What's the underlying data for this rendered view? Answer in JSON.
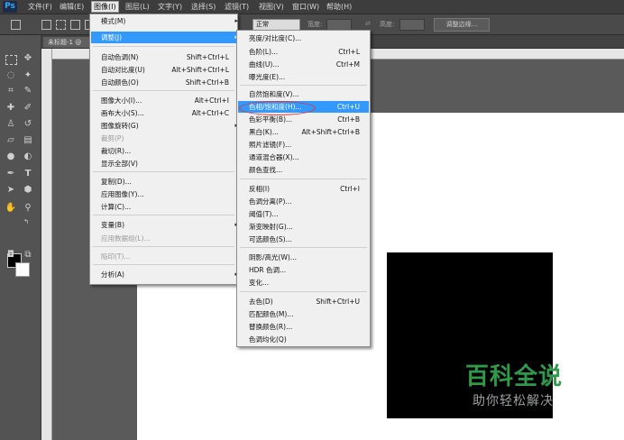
{
  "app": {
    "logo": "Ps"
  },
  "menubar": {
    "items": [
      "文件(F)",
      "编辑(E)",
      "图像(I)",
      "图层(L)",
      "文字(Y)",
      "选择(S)",
      "滤镜(T)",
      "视图(V)",
      "窗口(W)",
      "帮助(H)"
    ],
    "active": "图像(I)"
  },
  "options_bar": {
    "mode_value": "正常",
    "opacity_label": "宽度:",
    "height_label": "高度:",
    "adjust_edge_button": "调整边缘..."
  },
  "document": {
    "tab_title": "未标题-1 @"
  },
  "image_menu": {
    "items": [
      {
        "label": "模式(M)",
        "shortcut": "",
        "submenu": true
      },
      {
        "label": "调整(J)",
        "shortcut": "",
        "submenu": true,
        "highlighted": true
      },
      {
        "label": "自动色调(N)",
        "shortcut": "Shift+Ctrl+L"
      },
      {
        "label": "自动对比度(U)",
        "shortcut": "Alt+Shift+Ctrl+L"
      },
      {
        "label": "自动颜色(O)",
        "shortcut": "Shift+Ctrl+B"
      },
      {
        "label": "图像大小(I)...",
        "shortcut": "Alt+Ctrl+I"
      },
      {
        "label": "画布大小(S)...",
        "shortcut": "Alt+Ctrl+C"
      },
      {
        "label": "图像旋转(G)",
        "shortcut": "",
        "submenu": true
      },
      {
        "label": "裁剪(P)",
        "shortcut": "",
        "disabled": true
      },
      {
        "label": "裁切(R)...",
        "shortcut": ""
      },
      {
        "label": "显示全部(V)",
        "shortcut": ""
      },
      {
        "label": "复制(D)...",
        "shortcut": ""
      },
      {
        "label": "应用图像(Y)...",
        "shortcut": ""
      },
      {
        "label": "计算(C)...",
        "shortcut": ""
      },
      {
        "label": "变量(B)",
        "shortcut": "",
        "submenu": true
      },
      {
        "label": "应用数据组(L)...",
        "shortcut": "",
        "disabled": true
      },
      {
        "label": "陷印(T)...",
        "shortcut": "",
        "disabled": true
      },
      {
        "label": "分析(A)",
        "shortcut": "",
        "submenu": true
      }
    ]
  },
  "adjust_menu": {
    "items": [
      {
        "label": "亮度/对比度(C)...",
        "shortcut": ""
      },
      {
        "label": "色阶(L)...",
        "shortcut": "Ctrl+L"
      },
      {
        "label": "曲线(U)...",
        "shortcut": "Ctrl+M"
      },
      {
        "label": "曝光度(E)...",
        "shortcut": ""
      },
      {
        "label": "自然饱和度(V)...",
        "shortcut": ""
      },
      {
        "label": "色相/饱和度(H)...",
        "shortcut": "Ctrl+U",
        "highlighted": true
      },
      {
        "label": "色彩平衡(B)...",
        "shortcut": "Ctrl+B"
      },
      {
        "label": "黑白(K)...",
        "shortcut": "Alt+Shift+Ctrl+B"
      },
      {
        "label": "照片滤镜(F)...",
        "shortcut": ""
      },
      {
        "label": "通道混合器(X)...",
        "shortcut": ""
      },
      {
        "label": "颜色查找...",
        "shortcut": ""
      },
      {
        "label": "反相(I)",
        "shortcut": "Ctrl+I"
      },
      {
        "label": "色调分离(P)...",
        "shortcut": ""
      },
      {
        "label": "阈值(T)...",
        "shortcut": ""
      },
      {
        "label": "渐变映射(G)...",
        "shortcut": ""
      },
      {
        "label": "可选颜色(S)...",
        "shortcut": ""
      },
      {
        "label": "阴影/高光(W)...",
        "shortcut": ""
      },
      {
        "label": "HDR 色调...",
        "shortcut": ""
      },
      {
        "label": "变化...",
        "shortcut": ""
      },
      {
        "label": "去色(D)",
        "shortcut": "Shift+Ctrl+U"
      },
      {
        "label": "匹配颜色(M)...",
        "shortcut": ""
      },
      {
        "label": "替换颜色(R)...",
        "shortcut": ""
      },
      {
        "label": "色调均化(Q)",
        "shortcut": ""
      }
    ]
  },
  "watermark": {
    "title": "百科全说",
    "subtitle": "助你轻松解决"
  },
  "colors": {
    "highlight": "#3399ff",
    "oval": "#e0342c",
    "foreground": "#000000",
    "background": "#ffffff"
  },
  "icons": [
    "marquee-icon",
    "move-icon",
    "lasso-icon",
    "magic-wand-icon",
    "crop-icon",
    "eyedropper-icon",
    "healing-brush-icon",
    "brush-icon",
    "stamp-icon",
    "history-brush-icon",
    "eraser-icon",
    "gradient-icon",
    "blur-icon",
    "dodge-icon",
    "pen-icon",
    "type-icon",
    "path-select-icon",
    "shape-icon",
    "hand-icon",
    "zoom-icon"
  ]
}
